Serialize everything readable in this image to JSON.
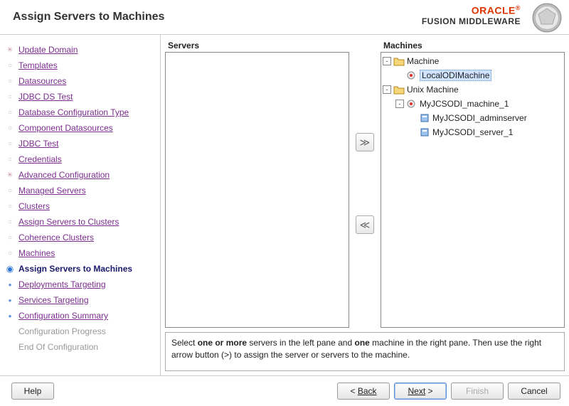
{
  "header": {
    "title": "Assign Servers to Machines",
    "brand": "ORACLE",
    "product": "FUSION MIDDLEWARE"
  },
  "sidebar": {
    "items": [
      {
        "label": "Update Domain",
        "state": "done major"
      },
      {
        "label": "Templates",
        "state": "done"
      },
      {
        "label": "Datasources",
        "state": "done"
      },
      {
        "label": "JDBC DS Test",
        "state": "done"
      },
      {
        "label": "Database Configuration Type",
        "state": "done"
      },
      {
        "label": "Component Datasources",
        "state": "done"
      },
      {
        "label": "JDBC Test",
        "state": "done"
      },
      {
        "label": "Credentials",
        "state": "done"
      },
      {
        "label": "Advanced Configuration",
        "state": "done major"
      },
      {
        "label": "Managed Servers",
        "state": "done"
      },
      {
        "label": "Clusters",
        "state": "done"
      },
      {
        "label": "Assign Servers to Clusters",
        "state": "done"
      },
      {
        "label": "Coherence Clusters",
        "state": "done"
      },
      {
        "label": "Machines",
        "state": "done"
      },
      {
        "label": "Assign Servers to Machines",
        "state": "current"
      },
      {
        "label": "Deployments Targeting",
        "state": "future"
      },
      {
        "label": "Services Targeting",
        "state": "future"
      },
      {
        "label": "Configuration Summary",
        "state": "future"
      },
      {
        "label": "Configuration Progress",
        "state": "disabled"
      },
      {
        "label": "End Of Configuration",
        "state": "disabled"
      }
    ]
  },
  "panes": {
    "servers_title": "Servers",
    "machines_title": "Machines"
  },
  "tree": [
    {
      "depth": 0,
      "icon": "folder",
      "toggle": "-",
      "label": "Machine",
      "selected": false
    },
    {
      "depth": 1,
      "icon": "machine",
      "toggle": "",
      "label": "LocalODIMachine",
      "selected": true
    },
    {
      "depth": 0,
      "icon": "folder",
      "toggle": "-",
      "label": "Unix Machine",
      "selected": false
    },
    {
      "depth": 1,
      "icon": "machine",
      "toggle": "-",
      "label": "MyJCSODI_machine_1",
      "selected": false
    },
    {
      "depth": 2,
      "icon": "server",
      "toggle": "",
      "label": "MyJCSODI_adminserver",
      "selected": false
    },
    {
      "depth": 2,
      "icon": "server",
      "toggle": "",
      "label": "MyJCSODI_server_1",
      "selected": false
    }
  ],
  "hint": {
    "b1": "one or more",
    "b2": "one"
  },
  "footer": {
    "help": "Help",
    "back": "Back",
    "next": "Next",
    "finish": "Finish",
    "cancel": "Cancel"
  }
}
